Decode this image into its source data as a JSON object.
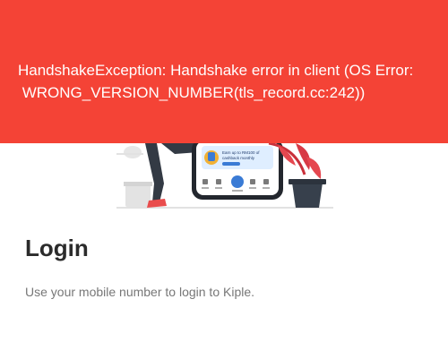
{
  "error": {
    "message": "HandshakeException: Handshake error in client (OS Error: \n WRONG_VERSION_NUMBER(tls_record.cc:242))",
    "background": "#f44336"
  },
  "illustration": {
    "promo_line1": "Earn up to RM100 of",
    "promo_line2": "cashback monthly",
    "icons": [
      "person-icon",
      "gift-icon",
      "scan-icon",
      "wallet-icon",
      "profile-icon"
    ]
  },
  "login": {
    "title": "Login",
    "subtitle": "Use your mobile number to login to Kiple."
  }
}
